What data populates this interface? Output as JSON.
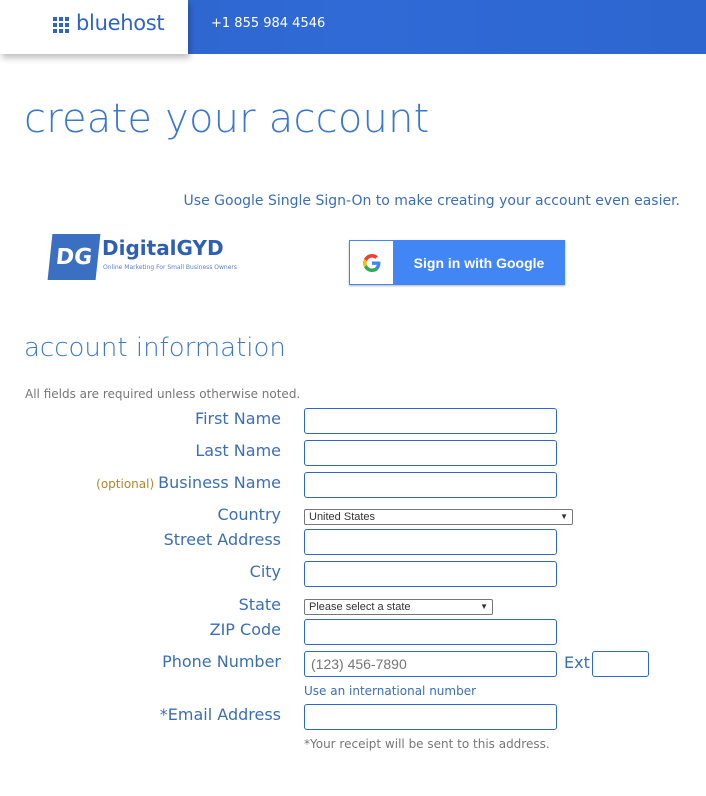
{
  "header": {
    "brand": "bluehost",
    "phone": "+1 855 984 4546"
  },
  "page": {
    "title": "create your account",
    "sso_text": "Use Google Single Sign-On to make creating your account even easier."
  },
  "watermark": {
    "badge": "DG",
    "name": "DigitalGYD",
    "tagline": "Online Marketing For Small Business Owners"
  },
  "google_button": {
    "label": "Sign in with Google"
  },
  "account": {
    "title": "account information",
    "note": "All fields are required unless otherwise noted.",
    "first_name_label": "First Name",
    "last_name_label": "Last Name",
    "optional": "(optional)",
    "business_name_label": "Business Name",
    "country_label": "Country",
    "country_value": "United States",
    "street_label": "Street Address",
    "city_label": "City",
    "state_label": "State",
    "state_value": "Please select a state",
    "zip_label": "ZIP Code",
    "phone_label": "Phone Number",
    "phone_value": "(123) 456-7890",
    "ext_label": "Ext",
    "intl_link": "Use an international number",
    "email_label": "*Email Address",
    "email_note": "*Your receipt will be sent to this address."
  },
  "colors": {
    "brand_blue": "#2f63c9",
    "label_blue": "#3b6eb5",
    "google_blue": "#4285f4",
    "optional_gold": "#b0862f"
  }
}
